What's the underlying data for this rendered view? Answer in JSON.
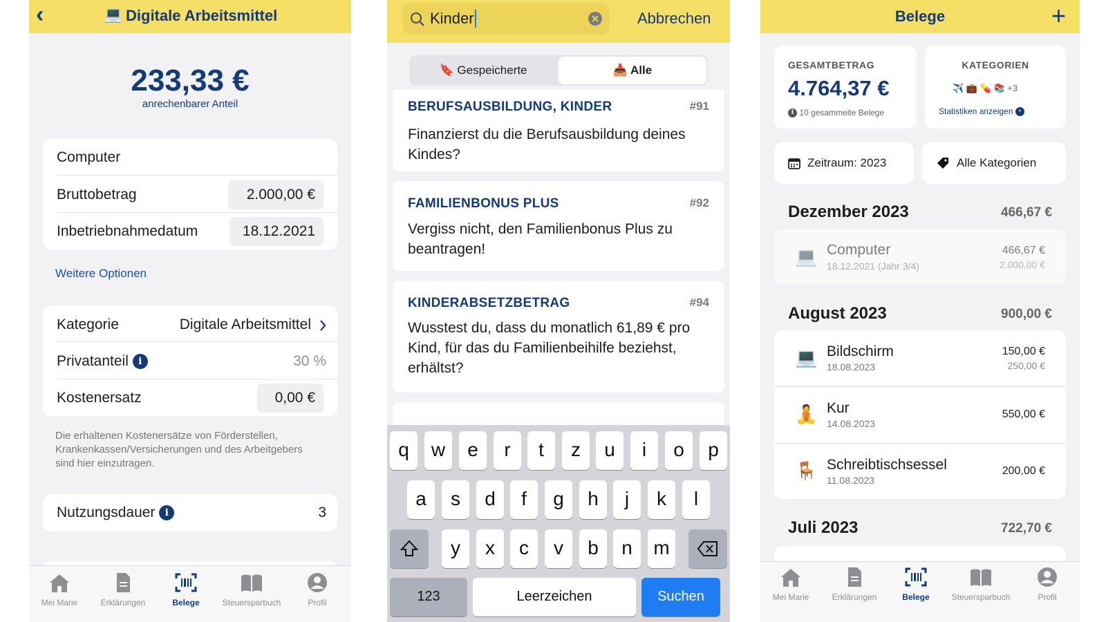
{
  "screen1": {
    "header": {
      "back": "‹",
      "emoji": "💻",
      "title": "Digitale Arbeitsmittel"
    },
    "amount": "233,33 €",
    "amount_label": "anrechenbarer Anteil",
    "form": {
      "name": "Computer",
      "brutto_label": "Bruttobetrag",
      "brutto_value": "2.000,00 €",
      "date_label": "Inbetriebnahmedatum",
      "date_value": "18.12.2021"
    },
    "more_options": "Weitere Optionen",
    "kategorie_label": "Kategorie",
    "kategorie_value": "Digitale Arbeitsmittel",
    "privat_label": "Privatanteil",
    "privat_value": "30 %",
    "kosten_label": "Kostenersatz",
    "kosten_value": "0,00 €",
    "note": "Die erhaltenen Kostenersätze von Förderstellen, Krankenkassen/Versicherungen und des Arbeitgebers sind hier einzutragen.",
    "nutzung_label": "Nutzungsdauer",
    "nutzung_value": "3",
    "info_glyph": "i"
  },
  "screen2": {
    "search_value": "Kinder",
    "cancel": "Abbrechen",
    "seg_saved": "Gespeicherte",
    "seg_all": "Alle",
    "results": [
      {
        "category": "BERUFSAUSBILDUNG, KINDER",
        "num": "#91",
        "text": "Finanzierst du die Berufsausbildung deines Kindes?"
      },
      {
        "category": "FAMILIENBONUS PLUS",
        "num": "#92",
        "text": "Vergiss nicht, den Familienbonus Plus zu beantragen!"
      },
      {
        "category": "KINDERABSETZBETRAG",
        "num": "#94",
        "text": "Wusstest du, dass du monatlich 61,89 € pro Kind, für das du Familienbeihilfe beziehst, erhältst?"
      }
    ],
    "keyboard": {
      "row1": [
        "q",
        "w",
        "e",
        "r",
        "t",
        "z",
        "u",
        "i",
        "o",
        "p"
      ],
      "row2": [
        "a",
        "s",
        "d",
        "f",
        "g",
        "h",
        "j",
        "k",
        "l"
      ],
      "row3": [
        "y",
        "x",
        "c",
        "v",
        "b",
        "n",
        "m"
      ],
      "num": "123",
      "space": "Leerzeichen",
      "go": "Suchen"
    }
  },
  "screen3": {
    "title": "Belege",
    "plus": "+",
    "total_label": "GESAMTBETRAG",
    "total_value": "4.764,37 €",
    "total_note": "10 gesammelte Belege",
    "cat_label": "KATEGORIEN",
    "cat_more": "+3",
    "cat_link": "Statistiken anzeigen",
    "filter_period": "Zeitraum: 2023",
    "filter_cat": "Alle Kategorien",
    "months": [
      {
        "name": "Dezember 2023",
        "total": "466,67 €"
      },
      {
        "name": "August 2023",
        "total": "900,00 €"
      },
      {
        "name": "Juli 2023",
        "total": "722,70 €"
      }
    ],
    "receipts": [
      {
        "name": "Computer",
        "date": "18.12.2021 (Jahr 3/4)",
        "amount": "466,67 €",
        "amount2": "2.000,00 €"
      },
      {
        "name": "Bildschirm",
        "date": "18.08.2023",
        "amount": "150,00 €",
        "amount2": "250,00 €"
      },
      {
        "name": "Kur",
        "date": "14.08.2023",
        "amount": "550,00 €",
        "amount2": ""
      },
      {
        "name": "Schreibtischsessel",
        "date": "11.08.2023",
        "amount": "200,00 €",
        "amount2": ""
      }
    ]
  },
  "tabbar": [
    "Mei Marie",
    "Erklärungen",
    "Belege",
    "Steuersparbuch",
    "Profil"
  ],
  "colors": {
    "yellow": "#f6df66",
    "navy": "#143a78",
    "key_blue": "#1f7cf2"
  }
}
